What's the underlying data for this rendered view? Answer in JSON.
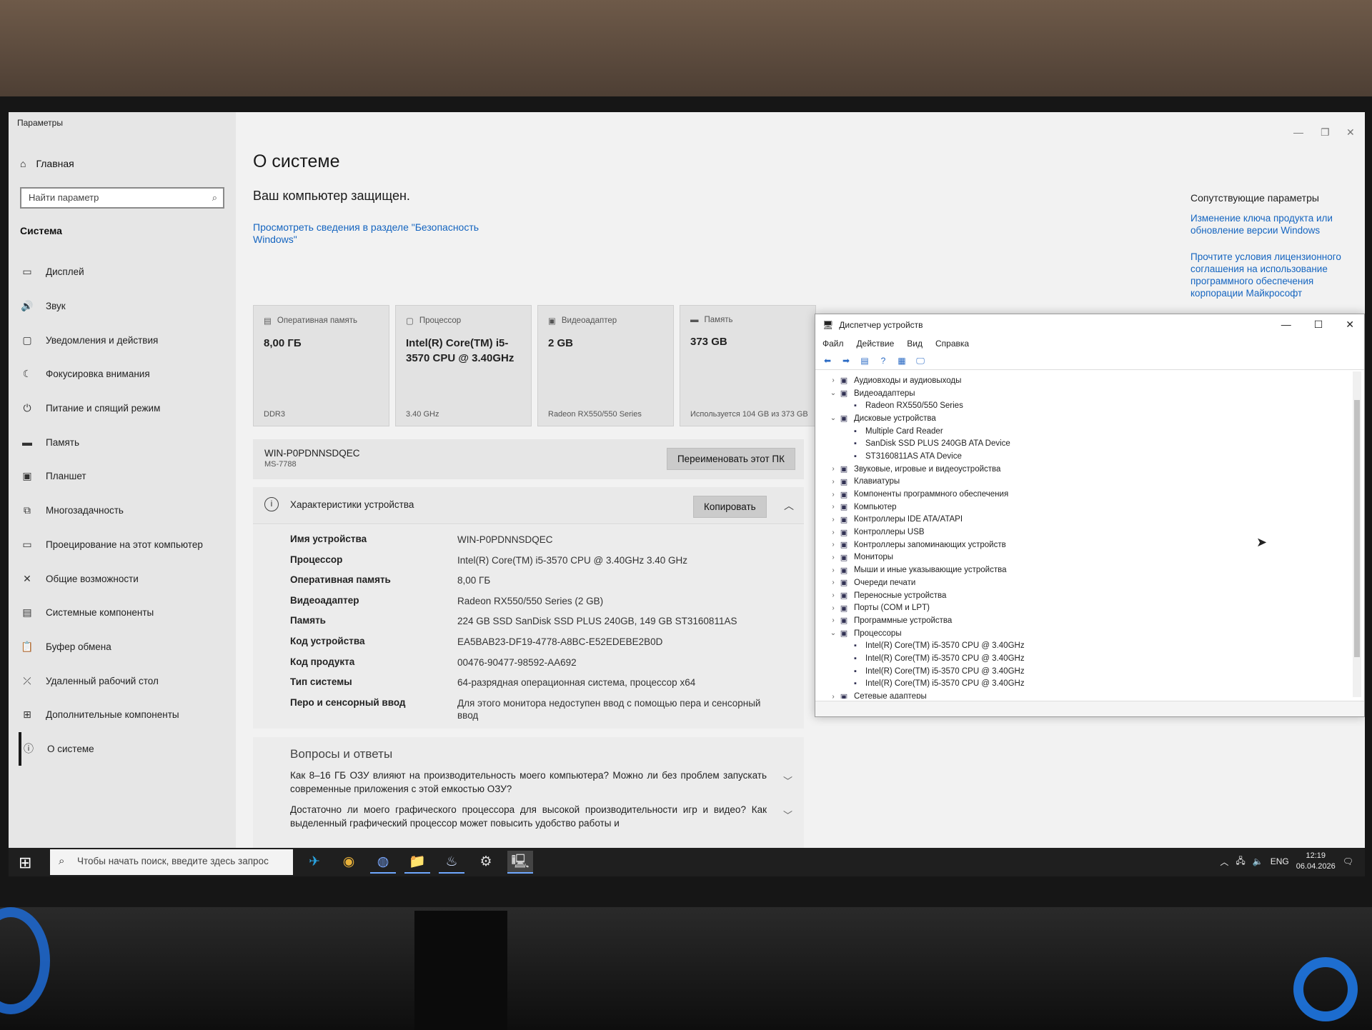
{
  "settings": {
    "app_title": "Параметры",
    "home": "Главная",
    "search_placeholder": "Найти параметр",
    "section": "Система",
    "nav": [
      {
        "label": "Дисплей",
        "icon": "display-icon"
      },
      {
        "label": "Звук",
        "icon": "sound-icon"
      },
      {
        "label": "Уведомления и действия",
        "icon": "notifications-icon"
      },
      {
        "label": "Фокусировка внимания",
        "icon": "focus-icon"
      },
      {
        "label": "Питание и спящий режим",
        "icon": "power-icon"
      },
      {
        "label": "Память",
        "icon": "storage-icon"
      },
      {
        "label": "Планшет",
        "icon": "tablet-icon"
      },
      {
        "label": "Многозадачность",
        "icon": "multitasking-icon"
      },
      {
        "label": "Проецирование на этот компьютер",
        "icon": "projecting-icon"
      },
      {
        "label": "Общие возможности",
        "icon": "shared-experiences-icon"
      },
      {
        "label": "Системные компоненты",
        "icon": "system-components-icon"
      },
      {
        "label": "Буфер обмена",
        "icon": "clipboard-icon"
      },
      {
        "label": "Удаленный рабочий стол",
        "icon": "remote-desktop-icon"
      },
      {
        "label": "Дополнительные компоненты",
        "icon": "optional-features-icon"
      },
      {
        "label": "О системе",
        "icon": "about-icon",
        "active": true
      }
    ],
    "page_title": "О системе",
    "protected": "Ваш компьютер защищен.",
    "security_link": "Просмотреть сведения в разделе \"Безопасность Windows\"",
    "cards": [
      {
        "label": "Оперативная память",
        "value": "8,00 ГБ",
        "sub": "DDR3",
        "icon": "ram-icon"
      },
      {
        "label": "Процессор",
        "value": "Intel(R) Core(TM) i5-3570 CPU @ 3.40GHz",
        "sub": "3.40 GHz",
        "icon": "cpu-icon"
      },
      {
        "label": "Видеоадаптер",
        "value": "2 GB",
        "sub": "Radeon RX550/550 Series",
        "icon": "gpu-icon"
      },
      {
        "label": "Память",
        "value": "373 GB",
        "sub": "Используется 104 GB из 373 GB",
        "icon": "storage-icon"
      }
    ],
    "pc_name": "WIN-P0PDNNSDQEC",
    "model": "MS-7788",
    "rename_button": "Переименовать этот ПК",
    "specs_title": "Характеристики устройства",
    "copy_button": "Копировать",
    "specs": [
      {
        "key": "Имя устройства",
        "value": "WIN-P0PDNNSDQEC"
      },
      {
        "key": "Процессор",
        "value": "Intel(R) Core(TM) i5-3570 CPU @ 3.40GHz   3.40 GHz"
      },
      {
        "key": "Оперативная память",
        "value": "8,00 ГБ"
      },
      {
        "key": "Видеоадаптер",
        "value": "Radeon RX550/550 Series (2 GB)"
      },
      {
        "key": "Память",
        "value": "224 GB SSD SanDisk SSD PLUS 240GB, 149 GB ST3160811AS"
      },
      {
        "key": "Код устройства",
        "value": "EA5BAB23-DF19-4778-A8BC-E52EDEBE2B0D"
      },
      {
        "key": "Код продукта",
        "value": "00476-90477-98592-AA692"
      },
      {
        "key": "Тип системы",
        "value": "64-разрядная операционная система, процессор x64"
      },
      {
        "key": "Перо и сенсорный ввод",
        "value": "Для этого монитора недоступен ввод с помощью пера и сенсорный ввод"
      }
    ],
    "faq_title": "Вопросы и ответы",
    "faq": [
      "Как 8–16 ГБ ОЗУ влияют на производительность моего компьютера? Можно ли без проблем запускать современные приложения с этой емкостью ОЗУ?",
      "Достаточно ли моего графического процессора для высокой производительности игр и видео? Как выделенный графический процессор может повысить удобство работы и"
    ],
    "related_title": "Сопутствующие параметры",
    "related_links": [
      "Изменение ключа продукта или обновление версии Windows",
      "Прочтите условия лицензионного соглашения на использование программного обеспечения корпорации Майкрософт"
    ]
  },
  "device_manager": {
    "title": "Диспетчер устройств",
    "menu": [
      "Файл",
      "Действие",
      "Вид",
      "Справка"
    ],
    "tree": [
      {
        "label": "Аудиовходы и аудиовыходы",
        "level": 0,
        "expanded": false
      },
      {
        "label": "Видеоадаптеры",
        "level": 0,
        "expanded": true
      },
      {
        "label": "Radeon RX550/550 Series",
        "level": 1
      },
      {
        "label": "Дисковые устройства",
        "level": 0,
        "expanded": true
      },
      {
        "label": "Multiple Card Reader",
        "level": 1
      },
      {
        "label": "SanDisk SSD PLUS 240GB ATA Device",
        "level": 1
      },
      {
        "label": "ST3160811AS ATA Device",
        "level": 1
      },
      {
        "label": "Звуковые, игровые и видеоустройства",
        "level": 0,
        "expanded": false
      },
      {
        "label": "Клавиатуры",
        "level": 0,
        "expanded": false
      },
      {
        "label": "Компоненты программного обеспечения",
        "level": 0,
        "expanded": false
      },
      {
        "label": "Компьютер",
        "level": 0,
        "expanded": false
      },
      {
        "label": "Контроллеры IDE ATA/ATAPI",
        "level": 0,
        "expanded": false
      },
      {
        "label": "Контроллеры USB",
        "level": 0,
        "expanded": false
      },
      {
        "label": "Контроллеры запоминающих устройств",
        "level": 0,
        "expanded": false
      },
      {
        "label": "Мониторы",
        "level": 0,
        "expanded": false
      },
      {
        "label": "Мыши и иные указывающие устройства",
        "level": 0,
        "expanded": false
      },
      {
        "label": "Очереди печати",
        "level": 0,
        "expanded": false
      },
      {
        "label": "Переносные устройства",
        "level": 0,
        "expanded": false
      },
      {
        "label": "Порты (COM и LPT)",
        "level": 0,
        "expanded": false
      },
      {
        "label": "Программные устройства",
        "level": 0,
        "expanded": false
      },
      {
        "label": "Процессоры",
        "level": 0,
        "expanded": true
      },
      {
        "label": "Intel(R) Core(TM) i5-3570 CPU @ 3.40GHz",
        "level": 1
      },
      {
        "label": "Intel(R) Core(TM) i5-3570 CPU @ 3.40GHz",
        "level": 1
      },
      {
        "label": "Intel(R) Core(TM) i5-3570 CPU @ 3.40GHz",
        "level": 1
      },
      {
        "label": "Intel(R) Core(TM) i5-3570 CPU @ 3.40GHz",
        "level": 1
      },
      {
        "label": "Сетевые адаптеры",
        "level": 0,
        "expanded": false
      }
    ]
  },
  "taskbar": {
    "search_placeholder": "Чтобы начать поиск, введите здесь запрос",
    "apps": [
      "telegram-icon",
      "chrome-icon",
      "browser-icon",
      "file-explorer-icon",
      "steam-icon",
      "settings-icon",
      "device-manager-icon"
    ],
    "language": "ENG",
    "time": "12:19",
    "date": "06.04.2026"
  }
}
